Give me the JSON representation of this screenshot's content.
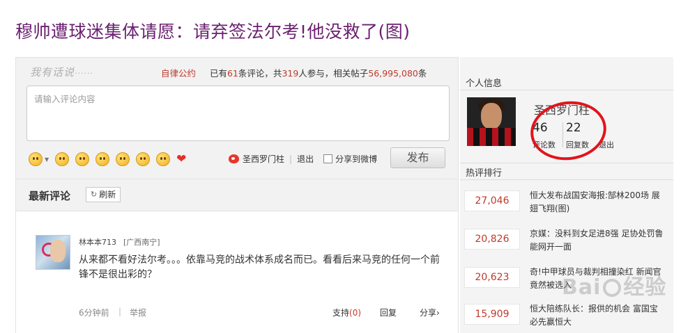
{
  "page": {
    "title": "穆帅遭球迷集体请愿：请弃签法尔考!他没救了(图)"
  },
  "comment_box": {
    "say_label": "我有话说",
    "say_dots": "······",
    "rules_link": "自律公约",
    "stats": {
      "prefix": "已有",
      "comments": "61",
      "comments_suffix": "条评论，共",
      "participants": "319",
      "participants_suffix": "人参与，相关帖子",
      "posts": "56,995,080",
      "posts_suffix": "条"
    },
    "input_placeholder": "请输入评论内容",
    "user_name": "圣西罗门柱",
    "logout": "退出",
    "share_weibo": "分享到微博",
    "publish": "发布"
  },
  "latest": {
    "title": "最新评论",
    "refresh": "刷新",
    "comment": {
      "user": "林本本713",
      "location": "[广西南宁]",
      "text": "从来都不看好法尔考。。。依靠马竞的战术体系成名而已。看看后来马竞的任何一个前锋不是很出彩的？",
      "time": "6分钟前",
      "report": "举报",
      "support_label": "支持",
      "support_count": "(0)",
      "reply": "回复",
      "share": "分享›"
    }
  },
  "sidebar": {
    "profile_title": "个人信息",
    "name": "圣西罗门柱",
    "comment_count": "46",
    "comment_label": "评论数",
    "reply_count": "22",
    "reply_label": "回复数",
    "logout": "退出",
    "ranking_title": "热评排行",
    "ranking": [
      {
        "count": "27,046",
        "title": "恒大发布战国安海报:郜林200场 展翅飞翔(图)"
      },
      {
        "count": "20,826",
        "title": "京媒：没料到女足进8强 足协处罚鲁能网开一面"
      },
      {
        "count": "20,623",
        "title": "奇!中甲球员与裁判相撞染红 新闻官竟然被选入"
      },
      {
        "count": "15,909",
        "title": "恒大陪练队长：报供的机会 富国宝必先赢恒大"
      }
    ]
  },
  "watermark": {
    "left": "Bai",
    "right": "经验"
  }
}
